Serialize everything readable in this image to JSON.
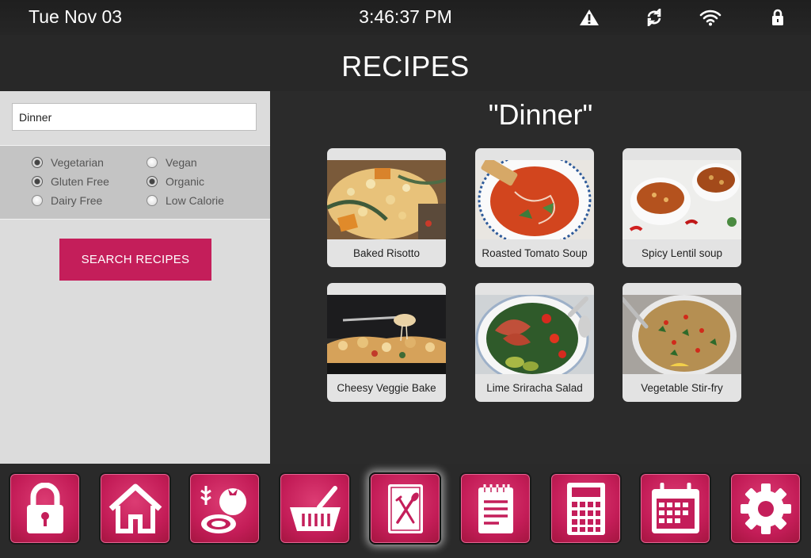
{
  "status": {
    "date": "Tue Nov 03",
    "time": "3:46:37 PM",
    "icons": [
      "warning-icon",
      "sync-icon",
      "wifi-icon",
      "lock-icon"
    ]
  },
  "page_title": "RECIPES",
  "search": {
    "value": "Dinner"
  },
  "filters": [
    {
      "label": "Vegetarian",
      "selected": true
    },
    {
      "label": "Vegan",
      "selected": false
    },
    {
      "label": "Gluten Free",
      "selected": true
    },
    {
      "label": "Organic",
      "selected": true
    },
    {
      "label": "Dairy Free",
      "selected": false
    },
    {
      "label": "Low Calorie",
      "selected": false
    }
  ],
  "search_button": "SEARCH RECIPES",
  "results_title": "\"Dinner\"",
  "recipes": [
    {
      "name": "Baked Risotto"
    },
    {
      "name": "Roasted Tomato Soup"
    },
    {
      "name": "Spicy Lentil soup"
    },
    {
      "name": "Cheesy Veggie Bake"
    },
    {
      "name": "Lime Sriracha Salad"
    },
    {
      "name": "Vegetable Stir-fry"
    }
  ],
  "dock": {
    "items": [
      "lock-icon",
      "home-icon",
      "groceries-icon",
      "basket-icon",
      "recipe-book-icon",
      "notepad-icon",
      "calculator-icon",
      "calendar-icon",
      "settings-gear-icon"
    ],
    "active": "recipe-book-icon"
  },
  "colors": {
    "accent": "#c41e5a",
    "background": "#2b2b2b",
    "panel": "#dcdcdc"
  }
}
